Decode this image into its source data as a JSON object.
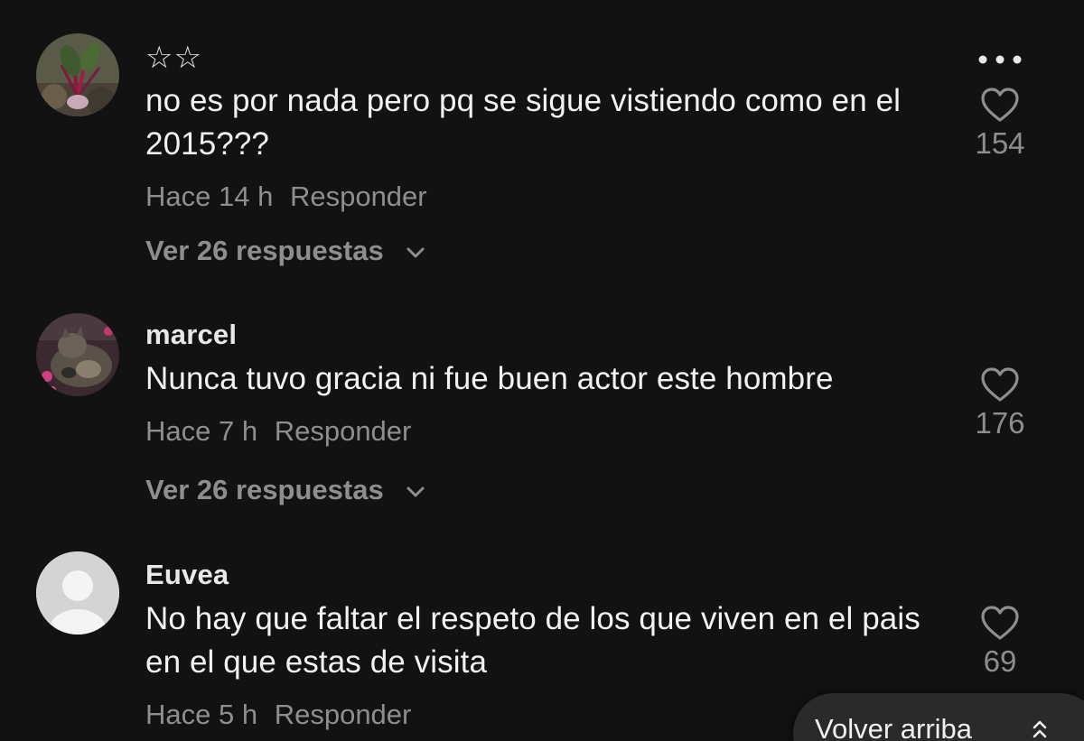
{
  "comments": [
    {
      "username": "☆☆",
      "text": "no es por nada pero pq se sigue vistiendo como en el 2015???",
      "time": "Hace 14 h",
      "reply_label": "Responder",
      "replies_label": "Ver 26 respuestas",
      "likes": "154",
      "avatar_icon": "plant-photo-avatar"
    },
    {
      "username": "marcel",
      "text": "Nunca tuvo gracia ni fue buen actor este hombre",
      "time": "Hace 7 h",
      "reply_label": "Responder",
      "replies_label": "Ver 26 respuestas",
      "likes": "176",
      "avatar_icon": "cat-photo-avatar"
    },
    {
      "username": "Euvea",
      "text": "No hay que faltar el respeto de los que viven en el pais en el que estas de visita",
      "time": "Hace 5 h",
      "reply_label": "Responder",
      "likes": "69",
      "avatar_icon": "default-user-avatar"
    }
  ],
  "back_to_top": {
    "label": "Volver arriba",
    "icon": "double-chevron-up-icon"
  },
  "colors": {
    "background": "#121212",
    "primary_text": "#f2f2f2",
    "secondary_text": "#8e8e8e",
    "pill": "#2a2a2a"
  }
}
